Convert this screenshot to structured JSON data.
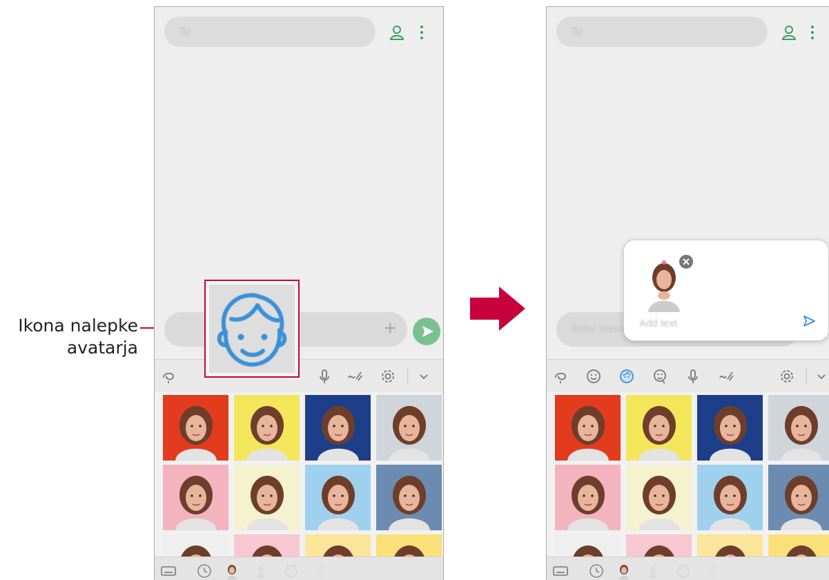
{
  "callout": {
    "line1": "Ikona nalepke",
    "line2": "avatarja"
  },
  "phone": {
    "to_placeholder": "To",
    "compose_placeholder": "Enter message",
    "popup_placeholder": "Add text"
  },
  "toolbar_icons": [
    "handwriting-icon",
    "emoji-icon",
    "avatar-sticker-icon",
    "gif-icon",
    "microphone-icon",
    "drawing-icon",
    "settings-icon",
    "collapse-icon"
  ],
  "bottom_icons": [
    "keyboard-icon",
    "recent-icon",
    "avatar-tab-icon",
    "sticker-pack-icon",
    "animal-sticker-icon",
    "figure-sticker-icon"
  ],
  "sticker_backgrounds": [
    "#e23b1e",
    "#f4e65a",
    "#1d3f8a",
    "#cfd5da",
    "#f3b4bf",
    "#f5f2cf",
    "#9fd0ee",
    "#6c8bb0",
    "#efefef",
    "#f7c7d2",
    "#fbe59a",
    "#fbe07a"
  ],
  "colors": {
    "accent": "#c8003c",
    "send": "#79c28f",
    "highlight": "#3b8fd8"
  }
}
